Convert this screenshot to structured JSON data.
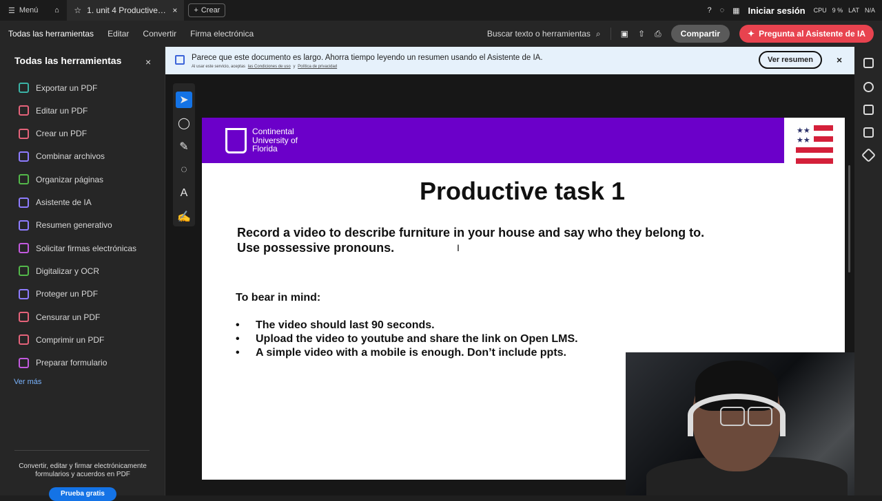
{
  "topbar": {
    "menu_label": "Menú",
    "tab_title": "1. unit  4 Productive t...",
    "create_label": "Crear",
    "signin_label": "Iniciar sesión",
    "sys_cpu": "CPU",
    "sys_cpu_value": "9 %",
    "sys_lat": "LAT",
    "sys_na": "N/A"
  },
  "toolbar": {
    "nav": [
      "Todas las herramientas",
      "Editar",
      "Convertir",
      "Firma electrónica"
    ],
    "search_label": "Buscar texto o herramientas",
    "share_label": "Compartir",
    "ai_label": "Pregunta al Asistente de IA"
  },
  "sidebar": {
    "title": "Todas las herramientas",
    "items": [
      {
        "label": "Exportar un PDF",
        "color": "#3bb3a6"
      },
      {
        "label": "Editar un PDF",
        "color": "#e5637a"
      },
      {
        "label": "Crear un PDF",
        "color": "#e5637a"
      },
      {
        "label": "Combinar archivos",
        "color": "#8e7cff"
      },
      {
        "label": "Organizar páginas",
        "color": "#53b84a"
      },
      {
        "label": "Asistente de IA",
        "color": "#8e7cff"
      },
      {
        "label": "Resumen generativo",
        "color": "#8e7cff"
      },
      {
        "label": "Solicitar firmas electrónicas",
        "color": "#c35adf"
      },
      {
        "label": "Digitalizar y OCR",
        "color": "#53b84a"
      },
      {
        "label": "Proteger un PDF",
        "color": "#8e7cff"
      },
      {
        "label": "Censurar un PDF",
        "color": "#e5637a"
      },
      {
        "label": "Comprimir un PDF",
        "color": "#e5637a"
      },
      {
        "label": "Preparar formulario",
        "color": "#c35adf"
      }
    ],
    "more_label": "Ver más",
    "promo_text": "Convertir, editar y firmar electrónicamente formularios y acuerdos en PDF",
    "trial_label": "Prueba gratis"
  },
  "banner": {
    "message": "Parece que este documento es largo. Ahorra tiempo leyendo un resumen usando el Asistente de IA.",
    "small_prefix": "Al usar este servicio, aceptas",
    "small_terms": "las Condiciones de uso",
    "small_and": "y",
    "small_privacy": "Política de privacidad",
    "summary_label": "Ver resumen"
  },
  "document": {
    "logo_line1": "Continental",
    "logo_line2": "University of",
    "logo_line3": "Florida",
    "title": "Productive task 1",
    "task_line1": "Record a video to describe furniture in your house and say who they belong to.",
    "task_line2": "Use possessive pronouns.",
    "bear_title": "To bear in mind:",
    "bullets": [
      "The video should last 90 seconds.",
      "Upload the video to youtube and share the link on Open LMS.",
      "A simple video with a mobile is enough. Don’t include ppts."
    ],
    "brand_color": "#6b00c9"
  }
}
